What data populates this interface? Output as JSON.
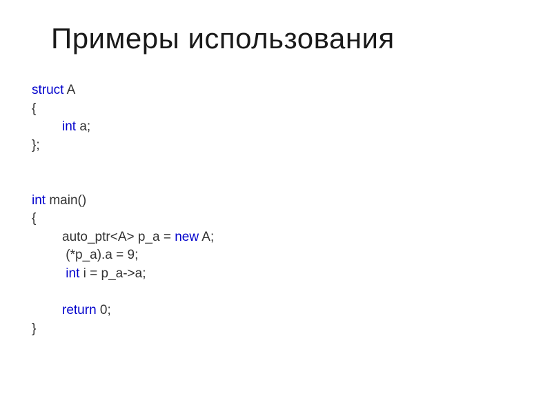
{
  "title": "Примеры использования",
  "code": {
    "kw_struct": "struct",
    "struct_name": " A",
    "brace_open": "{",
    "kw_int1": "int",
    "member_a": " a;",
    "struct_close": "};",
    "kw_int2": "int",
    "main_sig": " main()",
    "brace_open2": "{",
    "line_autoptr_pre": "auto_ptr<A> p_a = ",
    "kw_new": "new",
    "line_autoptr_post": " A;",
    "line_deref": " (*p_a).a = 9;",
    "kw_int3": " int",
    "line_arrow": " i = p_a->a;",
    "kw_return": "return",
    "return_val": " 0;",
    "brace_close": "}"
  }
}
